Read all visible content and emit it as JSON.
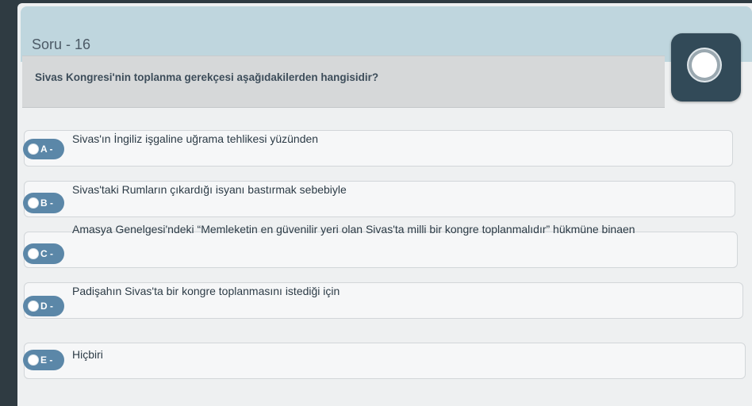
{
  "header": {
    "title": "Soru - 16"
  },
  "question": {
    "text": "Sivas Kongresi'nin toplanma gerekçesi aşağıdakilerden hangisidir?"
  },
  "options": [
    {
      "letter": "A -",
      "text": "Sivas'ın İngiliz işgaline uğrama tehlikesi yüzünden"
    },
    {
      "letter": "B -",
      "text": "Sivas'taki Rumların çıkardığı isyanı bastırmak sebebiyle"
    },
    {
      "letter": "C -",
      "text": "Amasya Genelgesi'ndeki “Memleketin en güvenilir yeri olan Sivas'ta milli bir kongre toplanmalıdır” hükmüne binaen"
    },
    {
      "letter": "D -",
      "text": "Padişahın Sivas'ta bir kongre toplanmasını istediği için"
    },
    {
      "letter": "E -",
      "text": "Hiçbiri"
    }
  ],
  "colors": {
    "header_band": "#bfd6de",
    "badge": "#5b87a8",
    "toggle": "#324a58"
  },
  "icons": {
    "toggle": "toggle-knob-icon",
    "radio": "radio-circle-icon"
  }
}
